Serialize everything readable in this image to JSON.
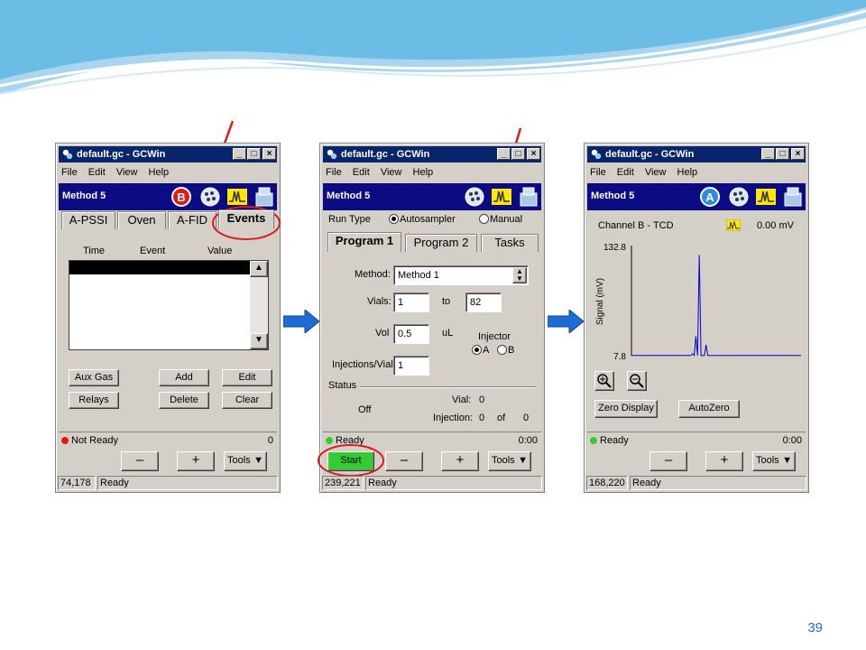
{
  "slide": {
    "page_number": "39"
  },
  "colors": {
    "title_bar": "#08246b",
    "method_bar": "#0b0c83",
    "start_green": "#33cc33",
    "arrow_blue": "#1e6bd6",
    "callout_red": "#e0191b"
  },
  "window_common": {
    "title": "default.gc - GCWin",
    "menu": [
      "File",
      "Edit",
      "View",
      "Help"
    ],
    "method_name": "Method 5",
    "btn_minus": "–",
    "btn_plus": "+",
    "btn_tools": "Tools"
  },
  "win1": {
    "tabs": [
      "A-PSSI",
      "Oven",
      "A-FID",
      "Events"
    ],
    "table_headers": [
      "Time",
      "Event",
      "Value"
    ],
    "buttons": [
      "Aux Gas",
      "Add",
      "Edit",
      "Relays",
      "Delete",
      "Clear"
    ],
    "status_text": "Not Ready",
    "status_value": "0",
    "coords": "74,178",
    "state": "Ready"
  },
  "win2": {
    "run_type_label": "Run Type",
    "run_type_options": [
      "Autosampler",
      "Manual"
    ],
    "tabs": [
      "Program 1",
      "Program 2",
      "Tasks"
    ],
    "method_label": "Method:",
    "method_value": "Method 1",
    "vials_label": "Vials:",
    "vial_from": "1",
    "to_label": "to",
    "vial_to": "82",
    "vol_label": "Vol",
    "vol_value": "0.5",
    "vol_unit": "uL",
    "injector_label": "Injector",
    "injector_options": [
      "A",
      "B"
    ],
    "inj_per_vial_label": "Injections/Vial",
    "inj_per_vial_value": "1",
    "status_label": "Status",
    "status_off": "Off",
    "vial_status_label": "Vial:",
    "vial_status_value": "0",
    "injection_label": "Injection:",
    "injection_value": "0",
    "of_label": "of",
    "injection_total": "0",
    "status_text": "Ready",
    "status_time": "0:00",
    "start_label": "Start",
    "coords": "239,221",
    "state": "Ready"
  },
  "win3": {
    "channel_label": "Channel B - TCD",
    "signal_value": "0.00 mV",
    "zero_display_label": "Zero Display",
    "autozero_label": "AutoZero",
    "status_text": "Ready",
    "status_time": "0:00",
    "coords": "168,220",
    "state": "Ready"
  },
  "chart_data": {
    "type": "line",
    "ylabel": "Signal (mV)",
    "xlabel": "",
    "ylim": [
      7.8,
      132.8
    ],
    "ytick_labels": [
      "132.8",
      "7.8"
    ],
    "series": [
      {
        "points_time_fraction": [
          0,
          0.35,
          0.36,
          0.37,
          0.38,
          0.39,
          0.4,
          0.41,
          0.42,
          0.43,
          0.44,
          0.45,
          0.5,
          1.0
        ],
        "values": [
          8.0,
          8.0,
          10.0,
          8.0,
          30.0,
          8.0,
          122.0,
          8.0,
          8.0,
          8.0,
          20.0,
          8.0,
          8.0,
          8.0
        ]
      }
    ]
  }
}
